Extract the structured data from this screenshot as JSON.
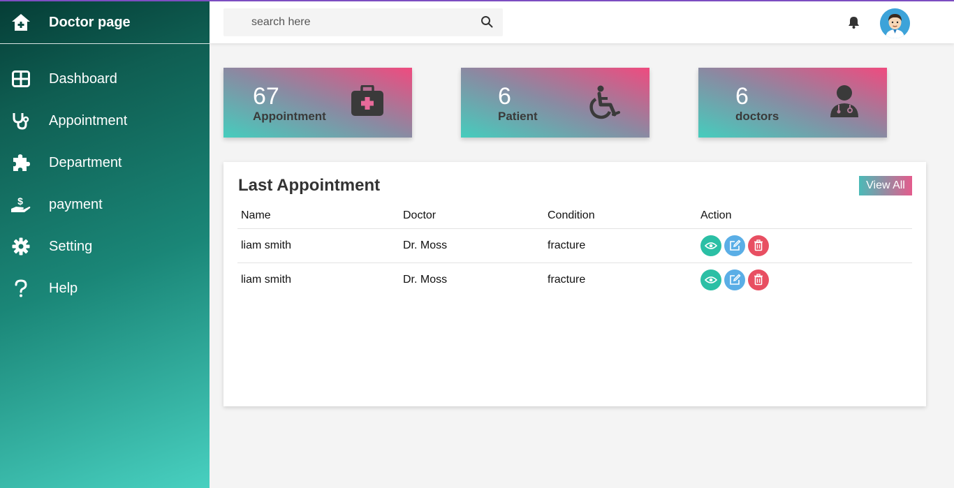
{
  "brand": {
    "title": "Doctor page",
    "icon": "home-plus-icon"
  },
  "sidebar": {
    "items": [
      {
        "label": "Dashboard",
        "icon": "grid-icon"
      },
      {
        "label": "Appointment",
        "icon": "stethoscope-icon"
      },
      {
        "label": "Department",
        "icon": "puzzle-icon"
      },
      {
        "label": "payment",
        "icon": "hand-dollar-icon"
      },
      {
        "label": "Setting",
        "icon": "gear-icon"
      },
      {
        "label": "Help",
        "icon": "question-icon"
      }
    ]
  },
  "topbar": {
    "search_placeholder": "search here",
    "icons": [
      "search-icon",
      "bell-icon",
      "avatar"
    ]
  },
  "cards": [
    {
      "value": "67",
      "label": "Appointment",
      "icon": "medical-kit-icon"
    },
    {
      "value": "6",
      "label": "Patient",
      "icon": "wheelchair-icon"
    },
    {
      "value": "6",
      "label": "doctors",
      "icon": "doctor-icon"
    }
  ],
  "panel": {
    "title": "Last Appointment",
    "view_all": "View All",
    "columns": [
      "Name",
      "Doctor",
      "Condition",
      "Action"
    ],
    "rows": [
      {
        "name": "liam smith",
        "doctor": "Dr. Moss",
        "condition": "fracture"
      },
      {
        "name": "liam smith",
        "doctor": "Dr. Moss",
        "condition": "fracture"
      }
    ]
  },
  "colors": {
    "accent_top": "#7d4ec2",
    "sidebar_dark": "#053d36",
    "sidebar_light": "#48d0c0",
    "view_btn": "#2bbfa5",
    "edit_btn": "#5aaee6",
    "delete_btn": "#e84f62"
  }
}
